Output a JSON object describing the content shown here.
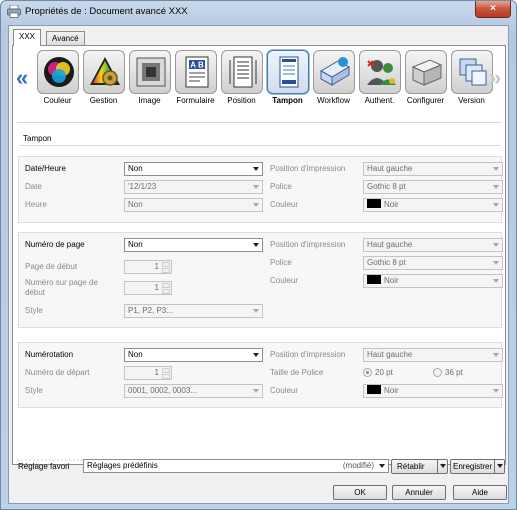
{
  "window": {
    "title": "Propriétés de : Document avancé XXX",
    "close_glyph": "×"
  },
  "tabs": [
    {
      "label": "XXX"
    },
    {
      "label": "Avancé"
    }
  ],
  "toolbar": {
    "items": [
      {
        "label": "Couleur",
        "icon": "color-wheel-icon"
      },
      {
        "label": "Gestion",
        "icon": "color-management-icon"
      },
      {
        "label": "Image",
        "icon": "image-icon"
      },
      {
        "label": "Formulaire",
        "icon": "form-icon"
      },
      {
        "label": "Position",
        "icon": "position-icon"
      },
      {
        "label": "Tampon",
        "icon": "stamp-icon",
        "selected": true
      },
      {
        "label": "Workflow",
        "icon": "workflow-icon"
      },
      {
        "label": "Authent.",
        "icon": "authentication-icon"
      },
      {
        "label": "Configurer",
        "icon": "printer-config-icon"
      },
      {
        "label": "Version",
        "icon": "version-icon"
      }
    ]
  },
  "section": {
    "title": "Tampon"
  },
  "date_group": {
    "label": "Date/Heure",
    "value": "Non",
    "date_label": "Date",
    "date_value": "'12/1/23",
    "time_label": "Heure",
    "time_value": "Non",
    "position_label": "Position d'impression",
    "position_value": "Haut gauche",
    "font_label": "Police",
    "font_value": "Gothic 8 pt",
    "color_label": "Couleur",
    "color_value": "Noir"
  },
  "page_group": {
    "label": "Numéro de page",
    "value": "Non",
    "start_label": "Page de début",
    "start_value": "1",
    "number_on_page_label": "Numéro sur page de début",
    "number_on_page_value": "1",
    "style_label": "Style",
    "style_value": "P1, P2, P3...",
    "position_label": "Position d'impression",
    "position_value": "Haut gauche",
    "font_label": "Police",
    "font_value": "Gothic 8 pt",
    "color_label": "Couleur",
    "color_value": "Noir"
  },
  "numbering_group": {
    "label": "Numérotation",
    "value": "Non",
    "start_label": "Numéro de départ",
    "start_value": "1",
    "style_label": "Style",
    "style_value": "0001, 0002, 0003...",
    "position_label": "Position d'impression",
    "position_value": "Haut gauche",
    "font_size_label": "Taille de Police",
    "font_size_options": [
      "20 pt",
      "36 pt"
    ],
    "font_size_selected": "20 pt",
    "color_label": "Couleur",
    "color_value": "Noir"
  },
  "favorites": {
    "label": "Réglage favori",
    "value": "Réglages prédéfinis",
    "modified": "(modifié)",
    "restore_label": "Rétablir",
    "save_label": "Enregistrer"
  },
  "buttons": {
    "ok": "OK",
    "cancel": "Annuler",
    "help": "Aide"
  },
  "colors": {
    "accent": "#3d6fb6",
    "title_bar": "#c9d9ec",
    "close": "#c7533b"
  }
}
